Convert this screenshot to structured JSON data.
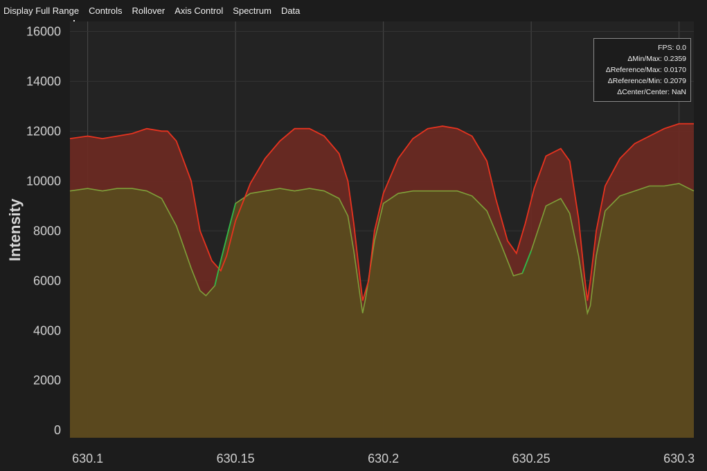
{
  "menu": {
    "items": [
      "Display Full Range",
      "Controls",
      "Rollover",
      "Axis Control",
      "Spectrum",
      "Data"
    ]
  },
  "stats": {
    "lines": [
      "FPS: 0.0",
      "ΔMin/Max: 0.2359",
      "ΔReference/Max: 0.0170",
      "ΔReference/Min: 0.2079",
      "ΔCenter/Center: NaN"
    ]
  },
  "colors": {
    "background": "#1c1c1c",
    "plot_background": "#232323",
    "grid": "#4a4a4a",
    "max_line": "#e8331f",
    "max_fill": "#6e2a22",
    "min_line": "#7fa03a",
    "min_fill": "#5a4a1f",
    "green_highlight": "#2fb84a"
  },
  "chart_data": {
    "type": "area",
    "title": "",
    "xlabel": "",
    "ylabel": "Intensity",
    "xlim": [
      630.094,
      630.305
    ],
    "ylim": [
      -300,
      16400
    ],
    "xticks": [
      630.1,
      630.15,
      630.2,
      630.25,
      630.3
    ],
    "xtick_labels": [
      "630.1",
      "630.15",
      "630.2",
      "630.25",
      "630.3"
    ],
    "yticks": [
      0,
      2000,
      4000,
      6000,
      8000,
      10000,
      12000,
      14000,
      16000
    ],
    "ytick_labels": [
      "0",
      "2000",
      "4000",
      "6000",
      "8000",
      "10000",
      "12000",
      "14000",
      "16000"
    ],
    "grid": true,
    "series": [
      {
        "x": [
          630.094,
          630.1,
          630.105,
          630.11,
          630.115,
          630.12,
          630.125,
          630.127,
          630.13,
          630.135,
          630.138,
          630.142,
          630.145,
          630.147,
          630.15,
          630.155,
          630.16,
          630.165,
          630.17,
          630.175,
          630.18,
          630.185,
          630.188,
          630.19,
          630.192,
          630.193,
          630.195,
          630.197,
          630.2,
          630.205,
          630.21,
          630.215,
          630.22,
          630.225,
          630.23,
          630.235,
          630.238,
          630.242,
          630.245,
          630.248,
          630.251,
          630.255,
          630.26,
          630.263,
          630.266,
          630.268,
          630.269,
          630.27,
          630.272,
          630.275,
          630.28,
          630.285,
          630.29,
          630.295,
          630.3,
          630.305
        ],
        "values": [
          11700,
          11800,
          11700,
          11800,
          11900,
          12100,
          12000,
          12000,
          11600,
          10000,
          8000,
          6800,
          6400,
          7000,
          8400,
          9900,
          10900,
          11600,
          12100,
          12100,
          11800,
          11100,
          10000,
          8300,
          6200,
          5200,
          6000,
          8000,
          9500,
          10900,
          11700,
          12100,
          12200,
          12100,
          11800,
          10800,
          9300,
          7600,
          7100,
          8300,
          9700,
          11000,
          11300,
          10800,
          8500,
          6200,
          5200,
          6000,
          8000,
          9800,
          10900,
          11500,
          11800,
          12100,
          12300,
          12300
        ]
      },
      {
        "x": [
          630.094,
          630.1,
          630.105,
          630.11,
          630.115,
          630.12,
          630.125,
          630.13,
          630.135,
          630.138,
          630.14,
          630.143,
          630.145,
          630.148,
          630.15,
          630.155,
          630.16,
          630.165,
          630.17,
          630.175,
          630.18,
          630.185,
          630.188,
          630.19,
          630.192,
          630.193,
          630.194,
          630.197,
          630.2,
          630.205,
          630.21,
          630.215,
          630.22,
          630.225,
          630.23,
          630.235,
          630.24,
          630.244,
          630.247,
          630.25,
          630.255,
          630.26,
          630.263,
          630.266,
          630.268,
          630.269,
          630.27,
          630.272,
          630.275,
          630.28,
          630.285,
          630.29,
          630.295,
          630.3,
          630.305
        ],
        "values": [
          9600,
          9700,
          9600,
          9700,
          9700,
          9600,
          9300,
          8200,
          6500,
          5600,
          5400,
          5800,
          6800,
          8200,
          9100,
          9500,
          9600,
          9700,
          9600,
          9700,
          9600,
          9300,
          8600,
          7200,
          5500,
          4700,
          5300,
          7600,
          9100,
          9500,
          9600,
          9600,
          9600,
          9600,
          9400,
          8800,
          7400,
          6200,
          6300,
          7200,
          9000,
          9300,
          8700,
          7000,
          5500,
          4700,
          5000,
          7000,
          8800,
          9400,
          9600,
          9800,
          9800,
          9900,
          9600
        ]
      }
    ]
  }
}
